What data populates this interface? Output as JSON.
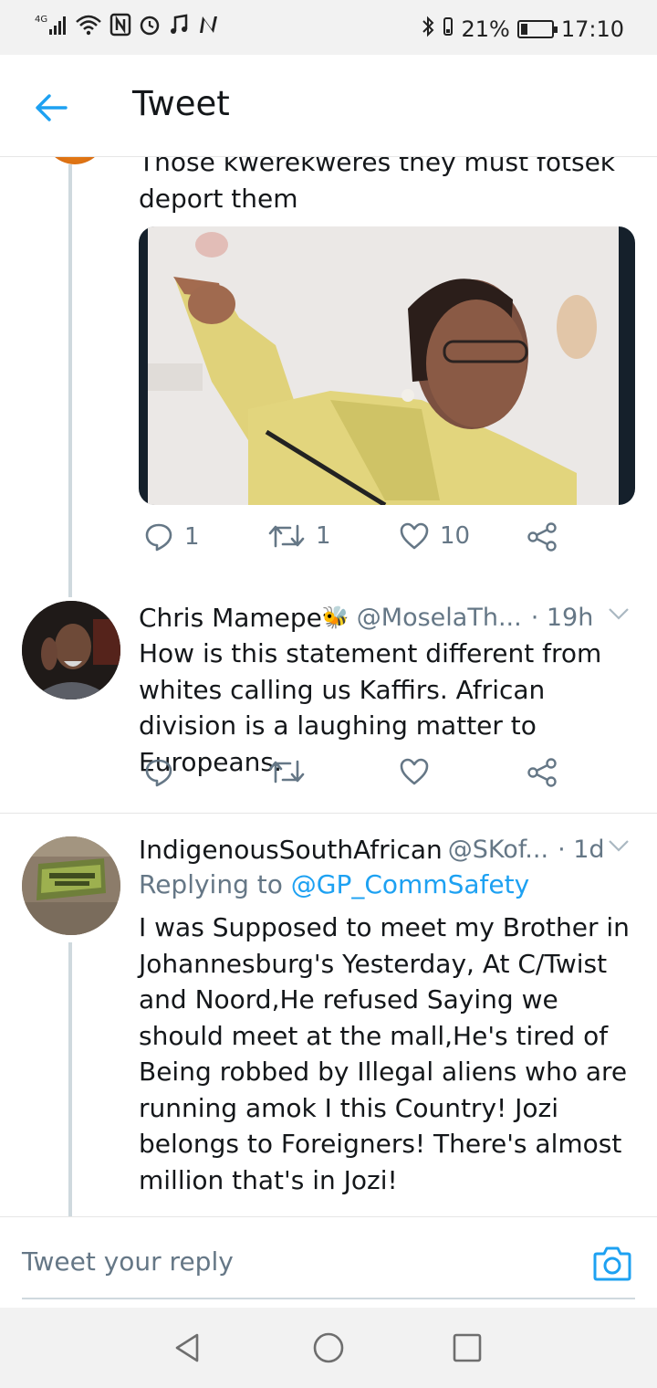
{
  "status_bar": {
    "network": "4G",
    "battery_percent": "21%",
    "time": "17:10",
    "battery_level": 0.21,
    "icons": [
      "signal-icon",
      "wifi-icon",
      "nfc-icon",
      "alarm-icon",
      "music-icon",
      "n-app-icon",
      "bluetooth-icon",
      "vibrate-icon",
      "battery-icon"
    ]
  },
  "header": {
    "title": "Tweet",
    "back_icon": "arrow-left-icon",
    "accent": "#1da1f2"
  },
  "tweets": [
    {
      "text_partial_top": "Those kwerekweres they must fotsek",
      "text": "deport them",
      "has_media": true,
      "actions": {
        "replies": "1",
        "retweets": "1",
        "likes": "10"
      }
    },
    {
      "display_name": "Chris Mamepe",
      "name_emoji": "🐝",
      "handle": "@MoselaTh...",
      "time": "· 19h",
      "text": "How is this statement different from whites calling us Kaffirs. African division is a laughing matter to Europeans.",
      "actions": {
        "replies": "",
        "retweets": "",
        "likes": ""
      }
    },
    {
      "display_name": "IndigenousSouthAfrican",
      "handle": "@SKof...",
      "time": "· 1d",
      "replying_to_label": "Replying to",
      "replying_to": "@GP_CommSafety",
      "text": "I was Supposed to meet my Brother in Johannesburg's Yesterday, At C/Twist and Noord,He refused Saying we should meet at the mall,He's tired of Being robbed by Illegal aliens who are running amok I this Country! Jozi belongs to Foreigners! There's almost million that's in Jozi!"
    }
  ],
  "composer": {
    "placeholder": "Tweet your reply",
    "camera_icon": "camera-icon"
  },
  "navbar": {
    "icons": [
      "back-triangle-icon",
      "home-circle-icon",
      "recents-square-icon"
    ]
  }
}
